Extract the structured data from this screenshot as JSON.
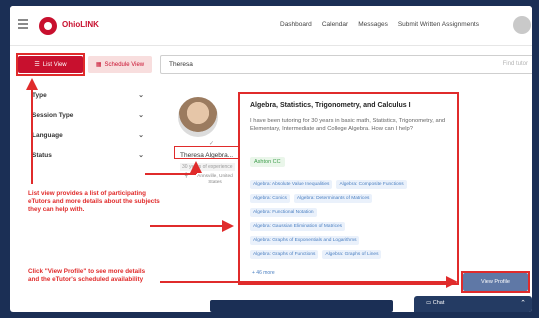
{
  "app": {
    "logo_text": "OhioLINK"
  },
  "nav": {
    "links": [
      "Dashboard",
      "Calendar",
      "Messages",
      "Submit Written Assignments"
    ]
  },
  "toolbar": {
    "list_view_label": "List View",
    "schedule_view_label": "Schedule View"
  },
  "search": {
    "value": "Theresa",
    "right_text": "Find tutor"
  },
  "filters": [
    {
      "label": "Type"
    },
    {
      "label": "Session Type"
    },
    {
      "label": "Language"
    },
    {
      "label": "Status"
    }
  ],
  "tutor": {
    "name": "Theresa Algebra...",
    "experience": "30 years of experience",
    "location": "Annsville, United States"
  },
  "subject": {
    "title": "Algebra, Statistics, Trigonometry, and Calculus I",
    "description": "I have been tutoring for 30 years in basic math, Statistics, Trigonometry, and Elementary, Intermediate and College Algebra. How can I help?",
    "education_chip": "Ashton CC",
    "tag_rows": [
      [
        "Algebra: Absolute Value Inequalities",
        "Algebra: Composite Functions"
      ],
      [
        "Algebra: Conics",
        "Algebra: Determinants of Matrices"
      ],
      [
        "Algebra: Functional Notation"
      ],
      [
        "Algebra: Gaussian Elimination of Matrices"
      ],
      [
        "Algebra: Graphs of Exponentials and Logarithms"
      ],
      [
        "Algebra: Graphs of Functions",
        "Algebra: Graphs of Lines"
      ]
    ],
    "more_link": "+ 46 more"
  },
  "view_profile_label": "View Profile",
  "chat": {
    "label": "Chat"
  },
  "annotations": {
    "list_view": "List view provides a list of participating eTutors and more details about the subjects they can help with.",
    "view_profile": "Click \"View Profile\" to see more details and the eTutor's scheduled availability"
  },
  "colors": {
    "brand_red": "#c8102e",
    "annotation_red": "#e02b2b",
    "frame_navy": "#1b2f55",
    "tag_blue": "#4a7fc1"
  }
}
